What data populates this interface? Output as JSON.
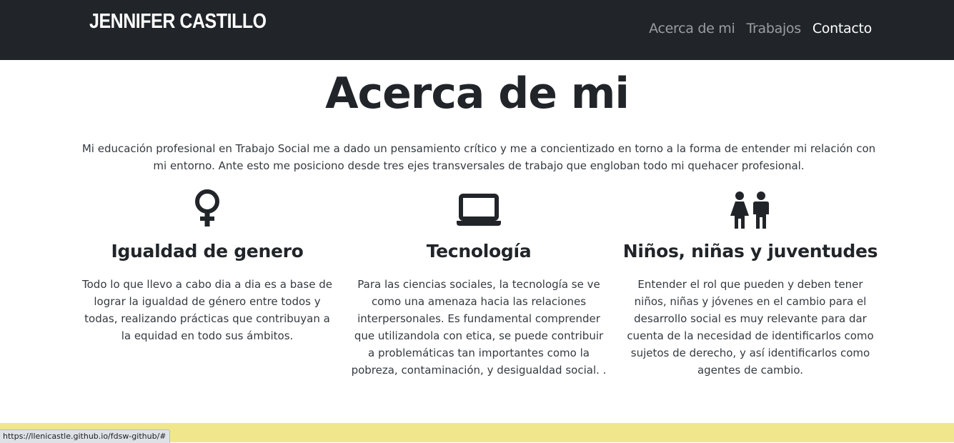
{
  "navbar": {
    "brand": "JENNIFER CASTILLO",
    "links": [
      {
        "label": "Acerca de mi",
        "active": false
      },
      {
        "label": "Trabajos",
        "active": false
      },
      {
        "label": "Contacto",
        "active": true
      }
    ]
  },
  "about": {
    "title": "Acerca de mi",
    "intro": "Mi educación profesional en Trabajo Social me a dado un pensamiento crítico y me a concientizado en torno a la forma de entender mi relación con mi entorno. Ante esto me posiciono desde tres ejes transversales de trabajo que engloban todo mi quehacer profesional.",
    "columns": [
      {
        "icon": "venus-icon",
        "title": "Igualdad de genero",
        "text": "Todo lo que llevo a cabo dia a dia es a base de lograr la igualdad de género entre todos y todas, realizando prácticas que contribuyan a la equidad en todo sus ámbitos."
      },
      {
        "icon": "laptop-icon",
        "title": "Tecnología",
        "text": "Para las ciencias sociales, la tecnología se ve como una amenaza hacia las relaciones interpersonales. Es fundamental comprender que utilizandola con etica, se puede contribuir a problemáticas tan importantes como la pobreza, contaminación, y desigualdad social. ."
      },
      {
        "icon": "children-icon",
        "title": "Niños, niñas y juventudes",
        "text": "Entender el rol que pueden y deben tener niños, niñas y jóvenes en el cambio para el desarrollo social es muy relevante para dar cuenta de la necesidad de identificarlos como sujetos de derecho, y así identificarlos como agentes de cambio."
      }
    ]
  },
  "status_bar": {
    "url": "https://llenicastle.github.io/fdsw-github/#"
  },
  "colors": {
    "navbar_bg": "#212529",
    "footer_band": "#f0e68c",
    "text": "#212529"
  }
}
